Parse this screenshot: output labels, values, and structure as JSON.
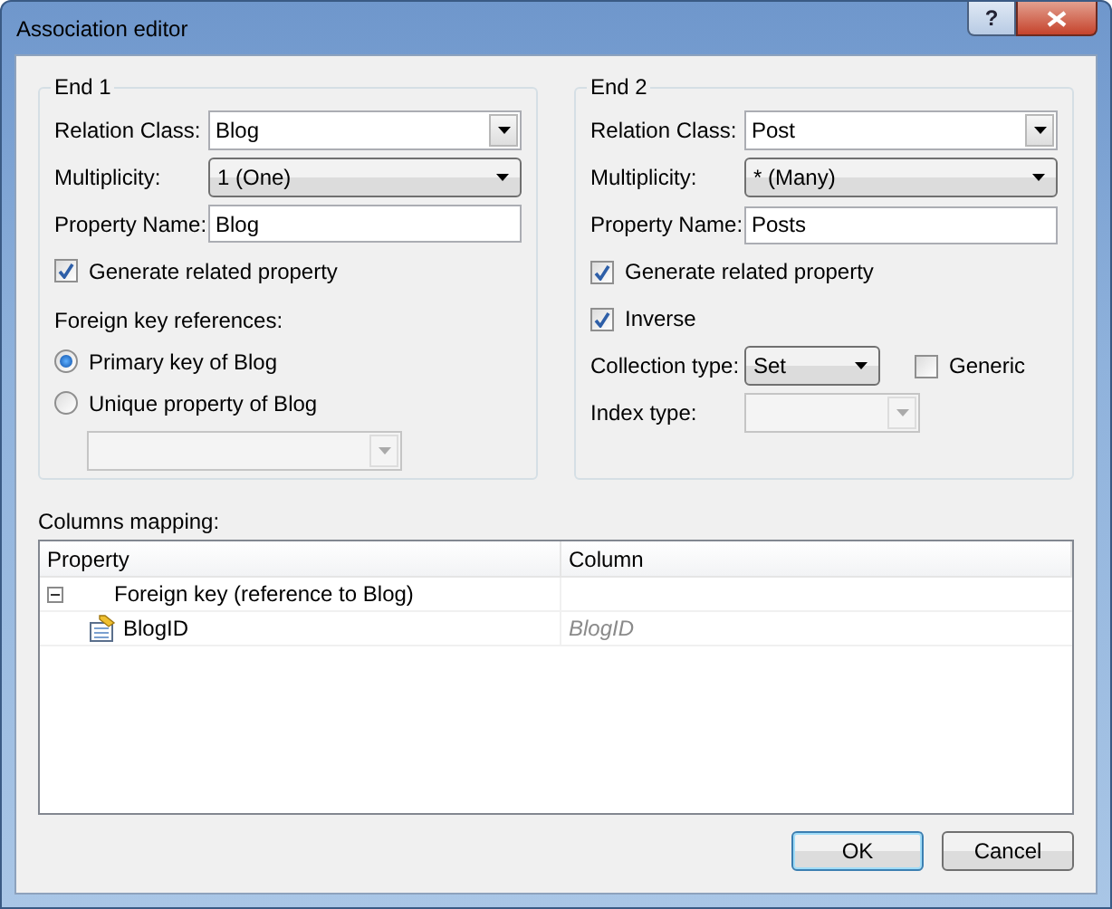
{
  "window": {
    "title": "Association editor",
    "help_label": "?"
  },
  "ends": [
    {
      "title": "End 1",
      "fields": [
        {
          "kind": "combo",
          "label": "Relation Class:",
          "value": "Blog"
        },
        {
          "kind": "dropdown",
          "label": "Multiplicity:",
          "value": "1 (One)"
        },
        {
          "kind": "text",
          "label": "Property Name:",
          "value": "Blog"
        },
        {
          "kind": "checkbox",
          "label": "Generate related property",
          "checked": true
        },
        {
          "kind": "heading",
          "label": "Foreign key references:"
        },
        {
          "kind": "radio",
          "label": "Primary key of Blog",
          "selected": true
        },
        {
          "kind": "radio",
          "label": "Unique property of Blog",
          "selected": false
        },
        {
          "kind": "sub-combo",
          "disabled": true
        }
      ]
    },
    {
      "title": "End 2",
      "fields": [
        {
          "kind": "combo",
          "label": "Relation Class:",
          "value": "Post"
        },
        {
          "kind": "dropdown",
          "label": "Multiplicity:",
          "value": "* (Many)"
        },
        {
          "kind": "text",
          "label": "Property Name:",
          "value": "Posts"
        },
        {
          "kind": "checkbox",
          "label": "Generate related property",
          "checked": true
        },
        {
          "kind": "checkbox",
          "label": "Inverse",
          "checked": true
        },
        {
          "kind": "small-dropdown",
          "label": "Collection type:",
          "value": "Set",
          "checkbox": {
            "label": "Generic",
            "checked": false
          }
        },
        {
          "kind": "small-combo",
          "label": "Index type:",
          "disabled": true
        }
      ]
    }
  ],
  "mapping": {
    "label": "Columns mapping:",
    "columns": [
      "Property",
      "Column"
    ],
    "rows": [
      {
        "property": "Foreign key (reference to Blog)",
        "expanded": true,
        "children": [
          {
            "property": "BlogID",
            "column": "BlogID"
          }
        ]
      }
    ]
  },
  "buttons": [
    {
      "label": "OK",
      "default": true
    },
    {
      "label": "Cancel",
      "default": false
    }
  ]
}
